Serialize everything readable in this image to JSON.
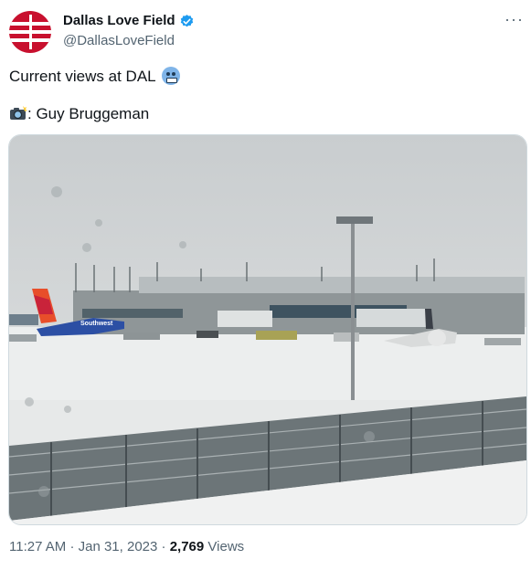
{
  "tweet": {
    "author": {
      "display_name": "Dallas Love Field",
      "handle": "@DallasLoveField",
      "verified": true,
      "avatar_icon": "dallas-love-field-logo",
      "brand_color": "#c8102e"
    },
    "more_label": "···",
    "text_line1": "Current views at DAL",
    "emoji1": "cold-face-emoji",
    "credit_label": ": Guy Bruggeman",
    "emoji2": "camera-flash-emoji",
    "media": {
      "type": "photo",
      "livery_text": "Southwest"
    },
    "time": "11:27 AM",
    "separator": "·",
    "date": "Jan 31, 2023",
    "separator2": "·",
    "views_count": "2,769",
    "views_label": "Views"
  }
}
